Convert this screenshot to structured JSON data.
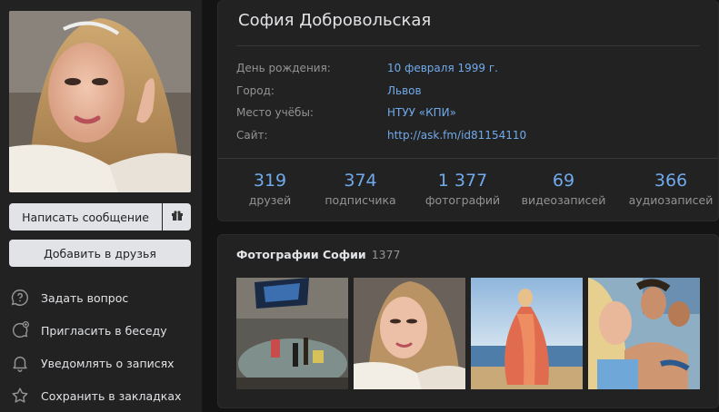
{
  "profile": {
    "name": "София Добровольская",
    "buttons": {
      "message": "Написать сообщение",
      "gift_icon": "gift-icon",
      "add_friend": "Добавить в друзья"
    },
    "menu": [
      {
        "label": "Задать вопрос",
        "icon": "question-icon"
      },
      {
        "label": "Пригласить в беседу",
        "icon": "chat-add-icon"
      },
      {
        "label": "Уведомлять о записях",
        "icon": "bell-icon"
      },
      {
        "label": "Сохранить в закладках",
        "icon": "star-icon"
      }
    ],
    "info": [
      {
        "label": "День рождения:",
        "value": "10 февраля 1999 г."
      },
      {
        "label": "Город:",
        "value": "Львов"
      },
      {
        "label": "Место учёбы:",
        "value": "НТУУ «КПИ»"
      },
      {
        "label": "Сайт:",
        "value": "http://ask.fm/id81154110"
      }
    ],
    "stats": [
      {
        "num": "319",
        "label": "друзей"
      },
      {
        "num": "374",
        "label": "подписчика"
      },
      {
        "num": "1 377",
        "label": "фотографий"
      },
      {
        "num": "69",
        "label": "видеозаписей"
      },
      {
        "num": "366",
        "label": "аудиозаписей"
      }
    ]
  },
  "photos": {
    "title": "Фотографии Софии",
    "count": "1377"
  },
  "colors": {
    "link": "#71aaeb",
    "muted": "#939393",
    "card": "#222222",
    "background": "#141414"
  }
}
